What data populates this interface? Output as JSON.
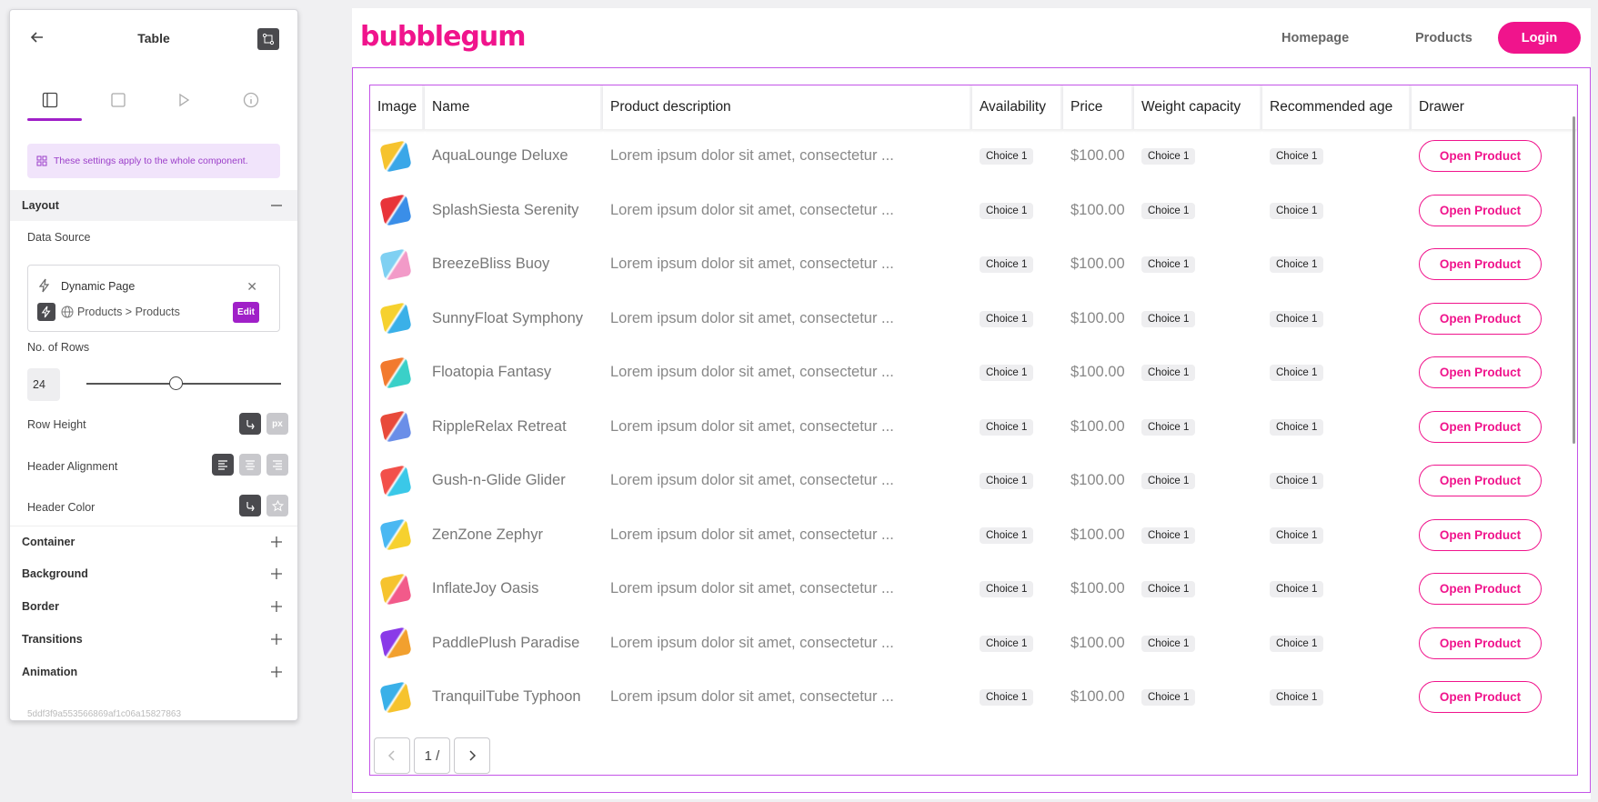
{
  "panel": {
    "title": "Table",
    "info_text": "These settings apply to the whole component.",
    "layout_label": "Layout",
    "data_source_label": "Data Source",
    "data_source_type": "Dynamic Page",
    "data_source_path": "Products > Products",
    "edit_label": "Edit",
    "rows_label": "No. of Rows",
    "rows_value": "24",
    "rows_slider_fraction": 0.46,
    "row_height_label": "Row Height",
    "row_height_unit": "px",
    "header_alignment_label": "Header Alignment",
    "header_color_label": "Header Color",
    "sections": [
      "Container",
      "Background",
      "Border",
      "Transitions",
      "Animation"
    ],
    "component_id": "5ddf3f9a553566869af1c06a15827863"
  },
  "site": {
    "logo": "bubblegum",
    "nav": [
      "Homepage",
      "Products"
    ],
    "login": "Login"
  },
  "table": {
    "headers": [
      "Image",
      "Name",
      "Product description",
      "Availability",
      "Price",
      "Weight capacity",
      "Recommended age",
      "Drawer"
    ],
    "rows": [
      {
        "name": "AquaLounge Deluxe",
        "desc": "Lorem ipsum dolor sit amet, consectetur ...",
        "avail": "Choice 1",
        "price": "$100.00",
        "weight": "Choice 1",
        "age": "Choice 1",
        "btn": "Open Product",
        "c1": "#f6c32e",
        "c2": "#3aa7e8"
      },
      {
        "name": "SplashSiesta Serenity",
        "desc": "Lorem ipsum dolor sit amet, consectetur ...",
        "avail": "Choice 1",
        "price": "$100.00",
        "weight": "Choice 1",
        "age": "Choice 1",
        "btn": "Open Product",
        "c1": "#e8343a",
        "c2": "#3a8ee8"
      },
      {
        "name": "BreezeBliss Buoy",
        "desc": "Lorem ipsum dolor sit amet, consectetur ...",
        "avail": "Choice 1",
        "price": "$100.00",
        "weight": "Choice 1",
        "age": "Choice 1",
        "btn": "Open Product",
        "c1": "#7fd0f2",
        "c2": "#f29ac8"
      },
      {
        "name": "SunnyFloat Symphony",
        "desc": "Lorem ipsum dolor sit amet, consectetur ...",
        "avail": "Choice 1",
        "price": "$100.00",
        "weight": "Choice 1",
        "age": "Choice 1",
        "btn": "Open Product",
        "c1": "#f6d12e",
        "c2": "#3ab0e8"
      },
      {
        "name": "Floatopia Fantasy",
        "desc": "Lorem ipsum dolor sit amet, consectetur ...",
        "avail": "Choice 1",
        "price": "$100.00",
        "weight": "Choice 1",
        "age": "Choice 1",
        "btn": "Open Product",
        "c1": "#f27a2e",
        "c2": "#3ad0c8"
      },
      {
        "name": "RippleRelax Retreat",
        "desc": "Lorem ipsum dolor sit amet, consectetur ...",
        "avail": "Choice 1",
        "price": "$100.00",
        "weight": "Choice 1",
        "age": "Choice 1",
        "btn": "Open Product",
        "c1": "#e84a3a",
        "c2": "#6a8ee8"
      },
      {
        "name": "Gush-n-Glide Glider",
        "desc": "Lorem ipsum dolor sit amet, consectetur ...",
        "avail": "Choice 1",
        "price": "$100.00",
        "weight": "Choice 1",
        "age": "Choice 1",
        "btn": "Open Product",
        "c1": "#f2504a",
        "c2": "#3ac8e8"
      },
      {
        "name": "ZenZone Zephyr",
        "desc": "Lorem ipsum dolor sit amet, consectetur ...",
        "avail": "Choice 1",
        "price": "$100.00",
        "weight": "Choice 1",
        "age": "Choice 1",
        "btn": "Open Product",
        "c1": "#4ab8f2",
        "c2": "#f6d12e"
      },
      {
        "name": "InflateJoy Oasis",
        "desc": "Lorem ipsum dolor sit amet, consectetur ...",
        "avail": "Choice 1",
        "price": "$100.00",
        "weight": "Choice 1",
        "age": "Choice 1",
        "btn": "Open Product",
        "c1": "#f6c32e",
        "c2": "#f25a8a"
      },
      {
        "name": "PaddlePlush Paradise",
        "desc": "Lorem ipsum dolor sit amet, consectetur ...",
        "avail": "Choice 1",
        "price": "$100.00",
        "weight": "Choice 1",
        "age": "Choice 1",
        "btn": "Open Product",
        "c1": "#8a3ae8",
        "c2": "#f2a02e"
      },
      {
        "name": "TranquilTube Typhoon",
        "desc": "Lorem ipsum dolor sit amet, consectetur ...",
        "avail": "Choice 1",
        "price": "$100.00",
        "weight": "Choice 1",
        "age": "Choice 1",
        "btn": "Open Product",
        "c1": "#3ab0e8",
        "c2": "#f6c32e"
      }
    ],
    "page_indicator": "1 /"
  },
  "colors": {
    "brand": "#f0148c",
    "accent": "#a020c8",
    "selection": "#c454e8"
  },
  "icons": {
    "back": "arrow-left-icon",
    "tool": "branch-icon",
    "tabs": [
      "layout-icon",
      "square-icon",
      "play-icon",
      "info-icon"
    ]
  }
}
